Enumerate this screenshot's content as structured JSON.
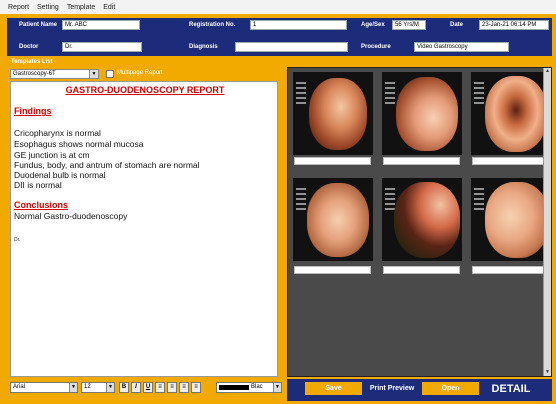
{
  "menu": [
    "Report",
    "Setting",
    "Template",
    "Edit"
  ],
  "header": {
    "patient_name_label": "Patient Name",
    "patient_name": "Mr. ABC",
    "registration_label": "Registration No.",
    "registration_no": "1",
    "age_sex_label": "Age/Sex",
    "age_sex": "56 Yrs/M",
    "date_label": "Date",
    "date": "23-Jan-21 06:14 PM",
    "doctor_label": "Doctor",
    "doctor": "Dr.",
    "diagnosis_label": "Diagnosis",
    "diagnosis": "",
    "procedure_label": "Procedure",
    "procedure": "Video Gastroscopy"
  },
  "templates": {
    "title": "Templates List",
    "selected": "Gastroscopy-6T",
    "multipage_label": "Multipage Report"
  },
  "report": {
    "title": "GASTRO-DUODENOSCOPY REPORT",
    "findings_heading": "Findings",
    "findings": [
      "Cricopharynx is normal",
      "Esophagus shows normal mucosa",
      "GE junction is at  cm",
      "Fundus, body, and antrum of stomach are normal",
      "Duodenal bulb is normal",
      "DII is normal"
    ],
    "conclusions_heading": "Conclusions",
    "conclusion": "Normal Gastro-duodenoscopy",
    "signature": "Dr."
  },
  "format": {
    "font": "Arial",
    "size": "12",
    "bold": "B",
    "italic": "I",
    "underline": "U",
    "color_name": "Blac"
  },
  "gallery": {
    "images": [
      {
        "icon": "endoscopy-image-1",
        "caption": ""
      },
      {
        "icon": "endoscopy-image-2",
        "caption": ""
      },
      {
        "icon": "endoscopy-image-3",
        "caption": ""
      },
      {
        "icon": "endoscopy-image-4",
        "caption": ""
      },
      {
        "icon": "endoscopy-image-5",
        "caption": ""
      },
      {
        "icon": "endoscopy-image-6",
        "caption": ""
      }
    ]
  },
  "actions": {
    "save": "Save",
    "print_preview": "Print Preview",
    "open": "Open",
    "detail": "DETAIL"
  },
  "colors": {
    "header_blue": "#1c2c7a",
    "frame_orange": "#f2a900",
    "report_red": "#d40000",
    "gallery_bg": "#4a4a4a"
  }
}
